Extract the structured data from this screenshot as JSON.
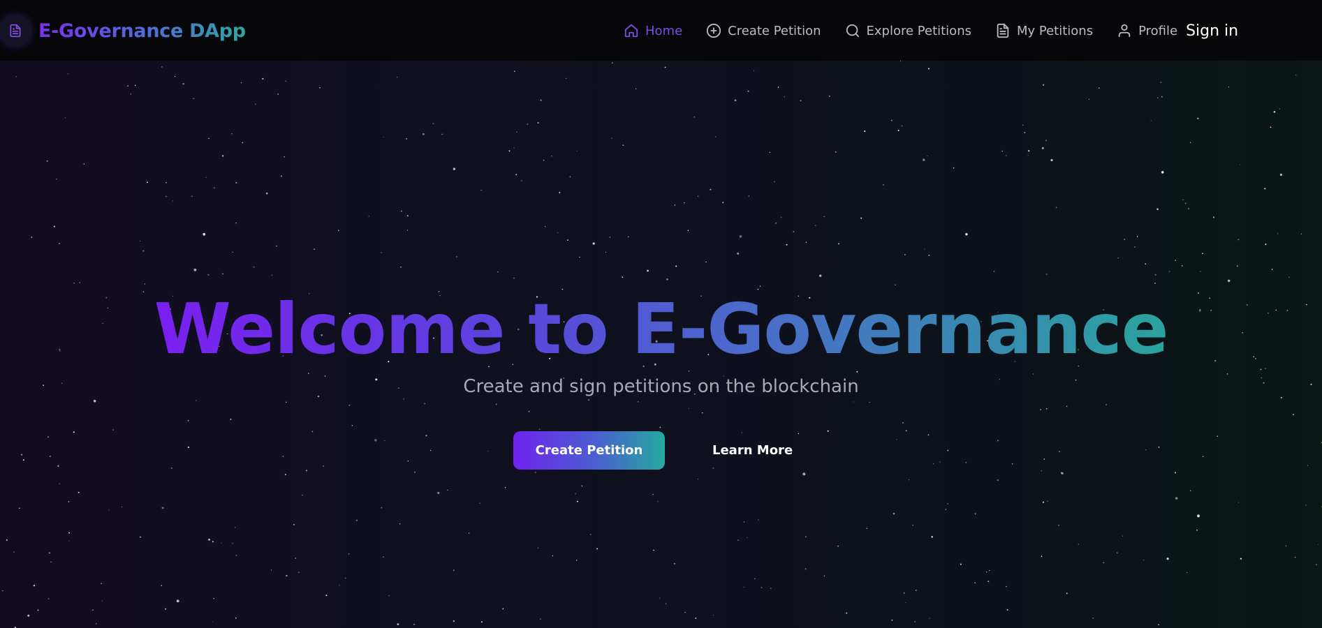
{
  "brand": {
    "title": "E-Governance DApp",
    "icon": "document-icon"
  },
  "nav": {
    "items": [
      {
        "label": "Home",
        "icon": "home-icon",
        "active": true
      },
      {
        "label": "Create Petition",
        "icon": "plus-circle-icon",
        "active": false
      },
      {
        "label": "Explore Petitions",
        "icon": "search-icon",
        "active": false
      },
      {
        "label": "My Petitions",
        "icon": "file-text-icon",
        "active": false
      },
      {
        "label": "Profile",
        "icon": "user-icon",
        "active": false
      }
    ],
    "sign_in_label": "Sign in"
  },
  "hero": {
    "title": "Welcome to E-Governance",
    "subtitle": "Create and sign petitions on the blockchain",
    "primary_button": "Create Petition",
    "secondary_button": "Learn More"
  },
  "colors": {
    "accent_purple": "#7a1ff0",
    "accent_teal": "#2aa39e",
    "header_bg": "#070709",
    "nav_text": "#b9bcc6",
    "nav_active": "#7c4be8"
  }
}
